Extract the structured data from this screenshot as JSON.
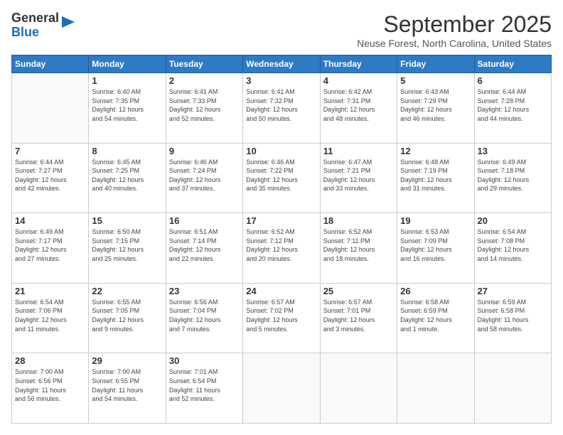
{
  "logo": {
    "line1": "General",
    "line2": "Blue"
  },
  "header": {
    "month": "September 2025",
    "location": "Neuse Forest, North Carolina, United States"
  },
  "weekdays": [
    "Sunday",
    "Monday",
    "Tuesday",
    "Wednesday",
    "Thursday",
    "Friday",
    "Saturday"
  ],
  "weeks": [
    [
      {
        "day": "",
        "info": ""
      },
      {
        "day": "1",
        "info": "Sunrise: 6:40 AM\nSunset: 7:35 PM\nDaylight: 12 hours\nand 54 minutes."
      },
      {
        "day": "2",
        "info": "Sunrise: 6:41 AM\nSunset: 7:33 PM\nDaylight: 12 hours\nand 52 minutes."
      },
      {
        "day": "3",
        "info": "Sunrise: 6:41 AM\nSunset: 7:32 PM\nDaylight: 12 hours\nand 50 minutes."
      },
      {
        "day": "4",
        "info": "Sunrise: 6:42 AM\nSunset: 7:31 PM\nDaylight: 12 hours\nand 48 minutes."
      },
      {
        "day": "5",
        "info": "Sunrise: 6:43 AM\nSunset: 7:29 PM\nDaylight: 12 hours\nand 46 minutes."
      },
      {
        "day": "6",
        "info": "Sunrise: 6:44 AM\nSunset: 7:28 PM\nDaylight: 12 hours\nand 44 minutes."
      }
    ],
    [
      {
        "day": "7",
        "info": "Sunrise: 6:44 AM\nSunset: 7:27 PM\nDaylight: 12 hours\nand 42 minutes."
      },
      {
        "day": "8",
        "info": "Sunrise: 6:45 AM\nSunset: 7:25 PM\nDaylight: 12 hours\nand 40 minutes."
      },
      {
        "day": "9",
        "info": "Sunrise: 6:46 AM\nSunset: 7:24 PM\nDaylight: 12 hours\nand 37 minutes."
      },
      {
        "day": "10",
        "info": "Sunrise: 6:46 AM\nSunset: 7:22 PM\nDaylight: 12 hours\nand 35 minutes."
      },
      {
        "day": "11",
        "info": "Sunrise: 6:47 AM\nSunset: 7:21 PM\nDaylight: 12 hours\nand 33 minutes."
      },
      {
        "day": "12",
        "info": "Sunrise: 6:48 AM\nSunset: 7:19 PM\nDaylight: 12 hours\nand 31 minutes."
      },
      {
        "day": "13",
        "info": "Sunrise: 6:49 AM\nSunset: 7:18 PM\nDaylight: 12 hours\nand 29 minutes."
      }
    ],
    [
      {
        "day": "14",
        "info": "Sunrise: 6:49 AM\nSunset: 7:17 PM\nDaylight: 12 hours\nand 27 minutes."
      },
      {
        "day": "15",
        "info": "Sunrise: 6:50 AM\nSunset: 7:15 PM\nDaylight: 12 hours\nand 25 minutes."
      },
      {
        "day": "16",
        "info": "Sunrise: 6:51 AM\nSunset: 7:14 PM\nDaylight: 12 hours\nand 22 minutes."
      },
      {
        "day": "17",
        "info": "Sunrise: 6:52 AM\nSunset: 7:12 PM\nDaylight: 12 hours\nand 20 minutes."
      },
      {
        "day": "18",
        "info": "Sunrise: 6:52 AM\nSunset: 7:11 PM\nDaylight: 12 hours\nand 18 minutes."
      },
      {
        "day": "19",
        "info": "Sunrise: 6:53 AM\nSunset: 7:09 PM\nDaylight: 12 hours\nand 16 minutes."
      },
      {
        "day": "20",
        "info": "Sunrise: 6:54 AM\nSunset: 7:08 PM\nDaylight: 12 hours\nand 14 minutes."
      }
    ],
    [
      {
        "day": "21",
        "info": "Sunrise: 6:54 AM\nSunset: 7:06 PM\nDaylight: 12 hours\nand 11 minutes."
      },
      {
        "day": "22",
        "info": "Sunrise: 6:55 AM\nSunset: 7:05 PM\nDaylight: 12 hours\nand 9 minutes."
      },
      {
        "day": "23",
        "info": "Sunrise: 6:56 AM\nSunset: 7:04 PM\nDaylight: 12 hours\nand 7 minutes."
      },
      {
        "day": "24",
        "info": "Sunrise: 6:57 AM\nSunset: 7:02 PM\nDaylight: 12 hours\nand 5 minutes."
      },
      {
        "day": "25",
        "info": "Sunrise: 6:57 AM\nSunset: 7:01 PM\nDaylight: 12 hours\nand 3 minutes."
      },
      {
        "day": "26",
        "info": "Sunrise: 6:58 AM\nSunset: 6:59 PM\nDaylight: 12 hours\nand 1 minute."
      },
      {
        "day": "27",
        "info": "Sunrise: 6:59 AM\nSunset: 6:58 PM\nDaylight: 11 hours\nand 58 minutes."
      }
    ],
    [
      {
        "day": "28",
        "info": "Sunrise: 7:00 AM\nSunset: 6:56 PM\nDaylight: 11 hours\nand 56 minutes."
      },
      {
        "day": "29",
        "info": "Sunrise: 7:00 AM\nSunset: 6:55 PM\nDaylight: 11 hours\nand 54 minutes."
      },
      {
        "day": "30",
        "info": "Sunrise: 7:01 AM\nSunset: 6:54 PM\nDaylight: 11 hours\nand 52 minutes."
      },
      {
        "day": "",
        "info": ""
      },
      {
        "day": "",
        "info": ""
      },
      {
        "day": "",
        "info": ""
      },
      {
        "day": "",
        "info": ""
      }
    ]
  ]
}
